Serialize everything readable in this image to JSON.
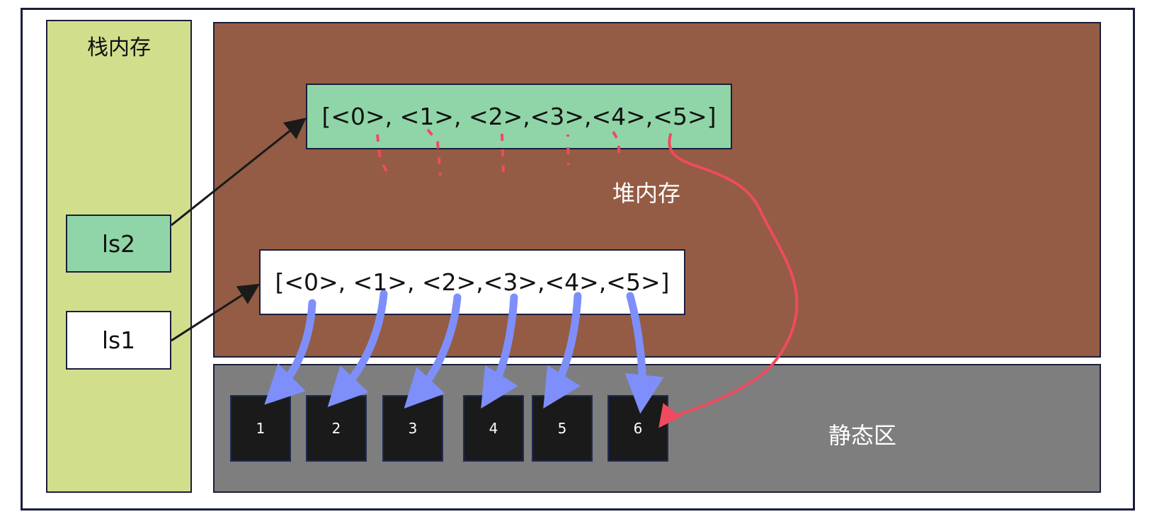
{
  "stack": {
    "title": "栈内存"
  },
  "heap": {
    "title": "堆内存"
  },
  "static_area": {
    "title": "静态区"
  },
  "variables": {
    "ls2": "ls2",
    "ls1": "ls1"
  },
  "lists": {
    "ls2_list": "[<0>, <1>, <2>,<3>,<4>,<5>]",
    "ls1_list": "[<0>, <1>, <2>,<3>,<4>,<5>]"
  },
  "integers": [
    "1",
    "2",
    "3",
    "4",
    "5",
    "6"
  ],
  "colors": {
    "stack_bg": "#d1df8d",
    "heap_bg": "#945c44",
    "static_bg": "#7e7e7e",
    "ls2_green": "#90d5a7",
    "blue_arrow": "#7e8ffb",
    "red_arrow": "#f04a5e",
    "black_arrow": "#1a1a1a"
  }
}
